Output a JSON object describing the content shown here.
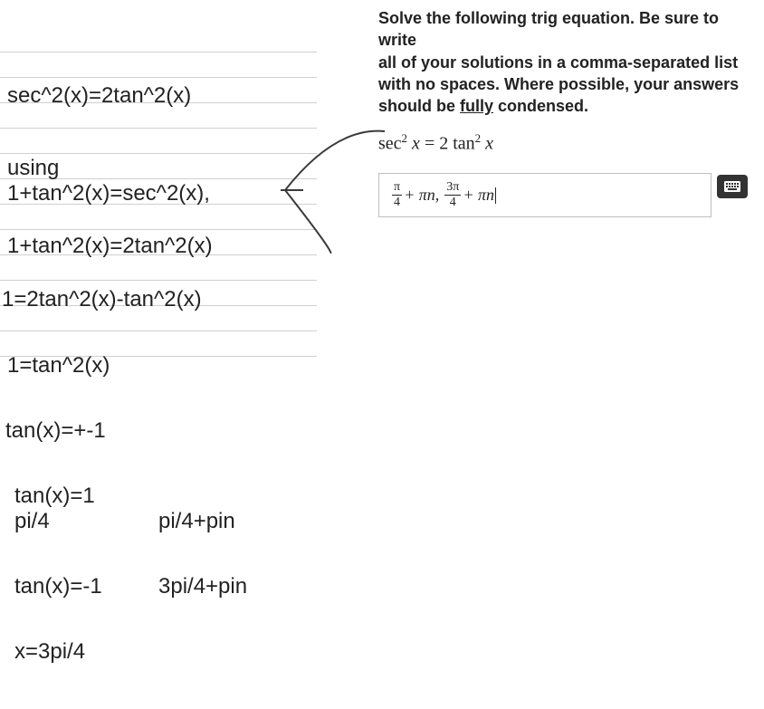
{
  "instructions": {
    "line1": "Solve the following trig equation. Be sure to write",
    "line2": "all of your solutions in a comma-separated list",
    "line3": "with no spaces. Where possible, your answers",
    "line4_prefix": "should be ",
    "line4_underlined": "fully",
    "line4_suffix": " condensed."
  },
  "equation": {
    "lhs_fn": "sec",
    "lhs_exp": "2",
    "lhs_var": "x",
    "eq": " = ",
    "rhs_coef": "2",
    "rhs_fn": "tan",
    "rhs_exp": "2",
    "rhs_var": "x"
  },
  "answer": {
    "frac1_num": "π",
    "frac1_den": "4",
    "plus1": " + πn,",
    "frac2_num": "3π",
    "frac2_den": "4",
    "plus2": " + πn"
  },
  "work": {
    "l1": "sec^2(x)=2tan^2(x)",
    "l2": "using",
    "l3": "1+tan^2(x)=sec^2(x),",
    "l4": "1+tan^2(x)=2tan^2(x)",
    "l5": "1=2tan^2(x)-tan^2(x)",
    "l6": "1=tan^2(x)",
    "l7": "tan(x)=+-1",
    "l8": "tan(x)=1",
    "l9": "pi/4",
    "l10": "pi/4+pin",
    "l11": "tan(x)=-1",
    "l12": "3pi/4+pin",
    "l13": "x=3pi/4"
  }
}
